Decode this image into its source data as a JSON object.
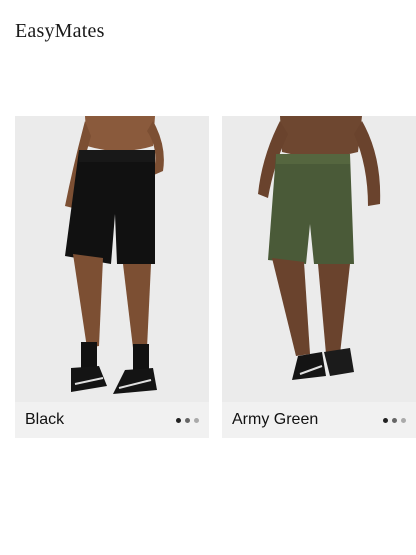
{
  "brand": {
    "name": "EasyMates"
  },
  "products": [
    {
      "color_label": "Black",
      "shorts_color": "#111111",
      "dots": 3,
      "active_dot": 1
    },
    {
      "color_label": "Army Green",
      "shorts_color": "#4a5a38",
      "dots": 3,
      "active_dot": 1
    }
  ]
}
